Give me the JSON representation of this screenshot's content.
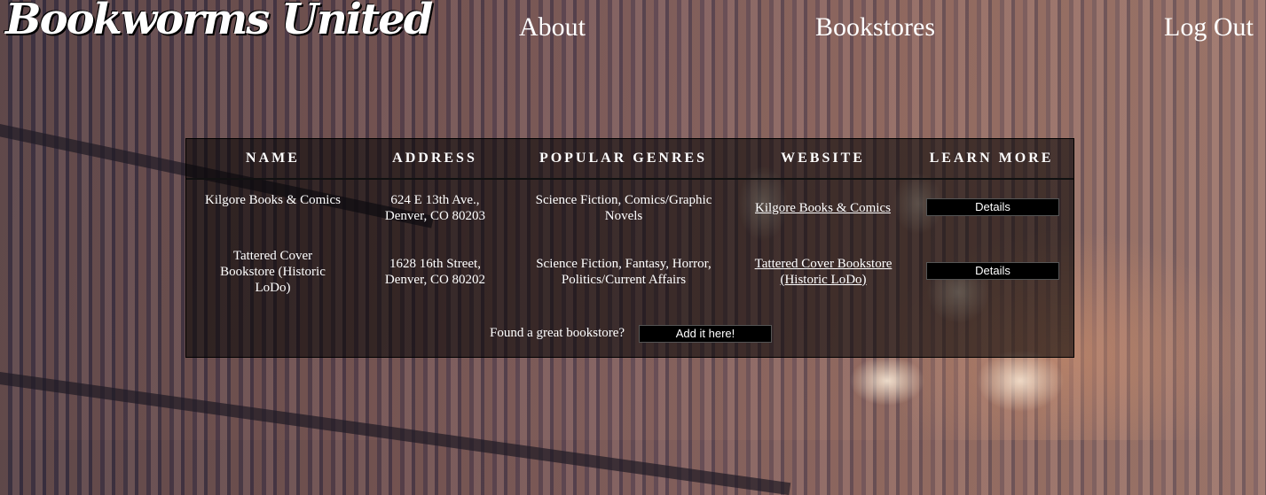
{
  "header": {
    "logo": "Bookworms United",
    "nav": [
      {
        "label": "About"
      },
      {
        "label": "Bookstores"
      },
      {
        "label": "Log Out"
      }
    ]
  },
  "table": {
    "columns": [
      "NAME",
      "ADDRESS",
      "POPULAR GENRES",
      "WEBSITE",
      "LEARN MORE"
    ],
    "rows": [
      {
        "name": "Kilgore Books & Comics",
        "address": "624 E 13th Ave., Denver, CO 80203",
        "genres": "Science Fiction, Comics/Graphic Novels",
        "website": "Kilgore Books & Comics",
        "button": "Details"
      },
      {
        "name": "Tattered Cover Bookstore (Historic LoDo)",
        "address": "1628 16th Street, Denver, CO 80202",
        "genres": "Science Fiction, Fantasy, Horror, Politics/Current Affairs",
        "website": "Tattered Cover Bookstore (Historic LoDo)",
        "button": "Details"
      }
    ]
  },
  "footer": {
    "prompt": "Found a great bookstore?",
    "button": "Add it here!"
  }
}
